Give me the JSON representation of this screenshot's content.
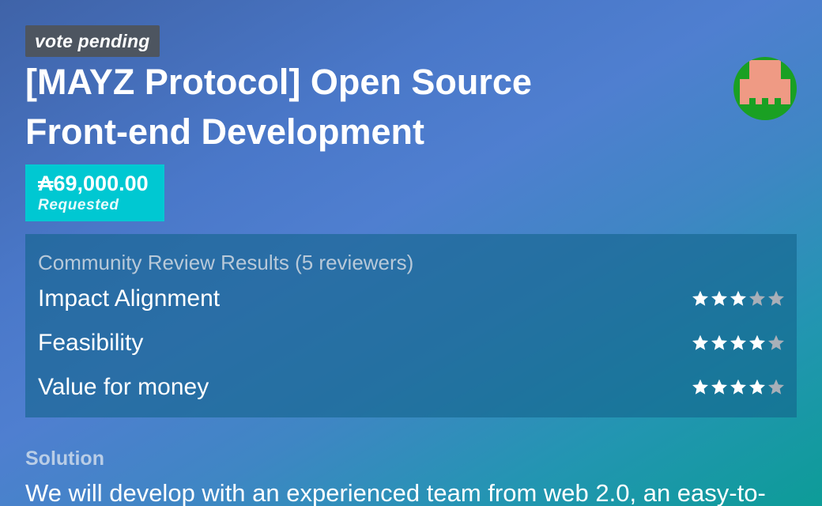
{
  "proposal": {
    "status": "vote pending",
    "title": "[MAYZ Protocol] Open Source Front-end Development",
    "avatar_icon": "pixel-identicon",
    "avatar_colors": {
      "background": "#1aa023",
      "figure": "#ef9a84"
    }
  },
  "funding": {
    "amount": "₳69,000.00",
    "label": "Requested"
  },
  "review": {
    "heading": "Community Review Results (5 reviewers)",
    "criteria": [
      {
        "label": "Impact Alignment",
        "rating": 3,
        "max": 5
      },
      {
        "label": "Feasibility",
        "rating": 4,
        "max": 5
      },
      {
        "label": "Value for money",
        "rating": 4,
        "max": 5
      }
    ],
    "star_colors": {
      "filled": "#ffffff",
      "empty": "#a8afb8"
    }
  },
  "solution": {
    "label": "Solution",
    "text": "We will develop with an experienced team from web 2.0, an easy-to-"
  }
}
